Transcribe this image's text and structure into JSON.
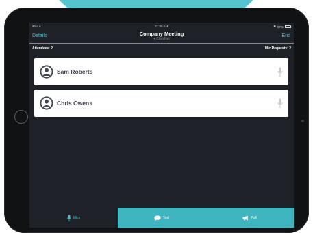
{
  "status_bar": {
    "device": "iPad",
    "time": "11:05 AM",
    "battery": "97%"
  },
  "nav": {
    "left_label": "Details",
    "title": "Company Meeting",
    "subtitle": "ChrisNet",
    "right_label": "End"
  },
  "info": {
    "attendees": "Attendees: 2",
    "mic_requests": "Mic Requests: 2"
  },
  "attendees": [
    {
      "name": "Sam Roberts"
    },
    {
      "name": "Chris Owens"
    }
  ],
  "tabs": [
    {
      "label": "Mics",
      "icon": "microphone-icon"
    },
    {
      "label": "Text",
      "icon": "chat-bubble-icon"
    },
    {
      "label": "Poll",
      "icon": "megaphone-icon"
    }
  ],
  "colors": {
    "accent": "#3fb6bf",
    "screen_bg": "#1e2228",
    "card_bg": "#ffffff",
    "name_text": "#414650"
  }
}
